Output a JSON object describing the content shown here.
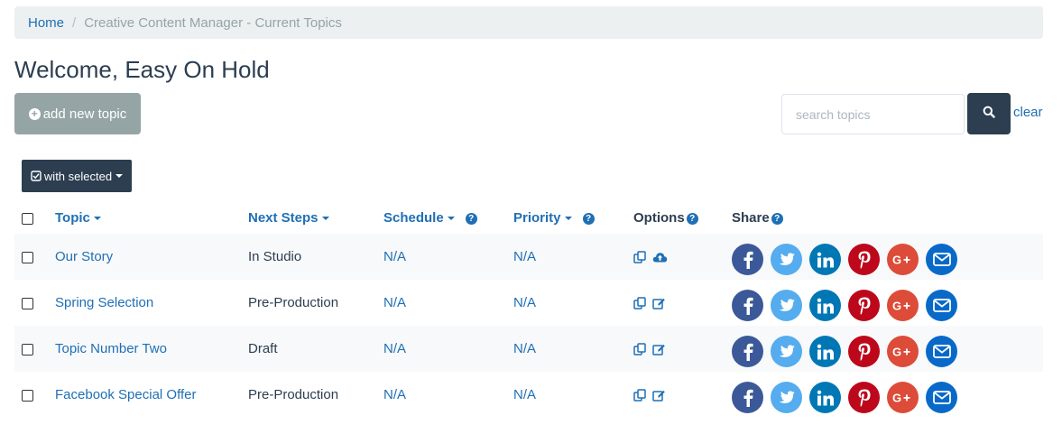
{
  "breadcrumb": {
    "home": "Home",
    "current": "Creative Content Manager - Current Topics"
  },
  "page": {
    "title": "Welcome, Easy On Hold"
  },
  "toolbar": {
    "add_label": "add new topic",
    "search_placeholder": "search topics",
    "search_value": "",
    "clear_label": "clear",
    "with_selected_label": "with selected"
  },
  "table": {
    "headers": {
      "topic": "Topic",
      "next_steps": "Next Steps",
      "schedule": "Schedule",
      "priority": "Priority",
      "options": "Options",
      "share": "Share"
    },
    "rows": [
      {
        "topic": "Our Story",
        "next_steps": "In Studio",
        "schedule": "N/A",
        "priority": "N/A",
        "second_option_icon": "cloud-upload-icon"
      },
      {
        "topic": "Spring Selection",
        "next_steps": "Pre-Production",
        "schedule": "N/A",
        "priority": "N/A",
        "second_option_icon": "edit-icon"
      },
      {
        "topic": "Topic Number Two",
        "next_steps": "Draft",
        "schedule": "N/A",
        "priority": "N/A",
        "second_option_icon": "edit-icon"
      },
      {
        "topic": "Facebook Special Offer",
        "next_steps": "Pre-Production",
        "schedule": "N/A",
        "priority": "N/A",
        "second_option_icon": "edit-icon"
      }
    ]
  },
  "share_icons": [
    {
      "name": "facebook-icon",
      "color": "#3b5998"
    },
    {
      "name": "twitter-icon",
      "color": "#55acee"
    },
    {
      "name": "linkedin-icon",
      "color": "#0077b5"
    },
    {
      "name": "pinterest-icon",
      "color": "#bd081c"
    },
    {
      "name": "google-plus-icon",
      "color": "#dd4b39"
    },
    {
      "name": "email-icon",
      "color": "#0969c9"
    }
  ],
  "colors": {
    "primary": "#2c3e50",
    "link": "#1f6fb5",
    "muted_button": "#95a5a6",
    "breadcrumb_bg": "#ecf0f1",
    "striped_row": "#f8f9fa"
  }
}
